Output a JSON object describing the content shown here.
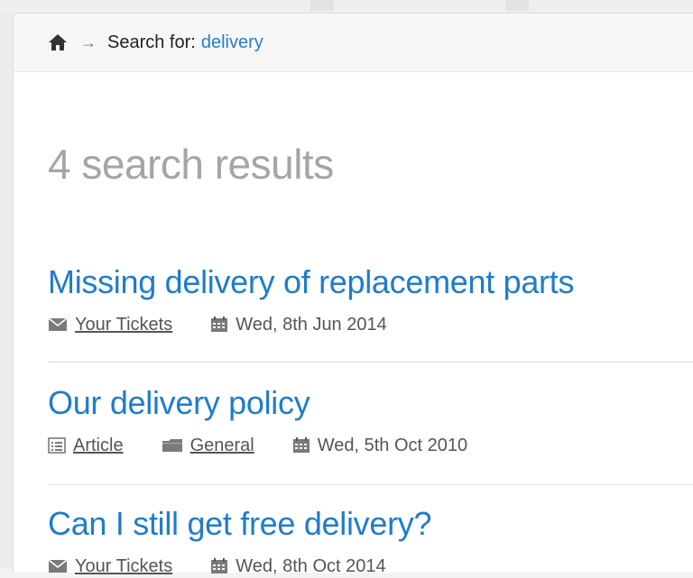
{
  "breadcrumb": {
    "home_icon": "home-icon",
    "separator": "→",
    "label": "Search for:",
    "query": "delivery"
  },
  "results_count": "4 search results",
  "results": [
    {
      "title": "Missing delivery of replacement parts",
      "meta": [
        {
          "icon": "envelope-icon",
          "text": "Your Tickets",
          "link": true
        },
        {
          "icon": "calendar-icon",
          "text": "Wed, 8th Jun 2014",
          "link": false
        }
      ]
    },
    {
      "title": "Our delivery policy",
      "meta": [
        {
          "icon": "article-icon",
          "text": "Article",
          "link": true
        },
        {
          "icon": "folder-icon",
          "text": "General",
          "link": true
        },
        {
          "icon": "calendar-icon",
          "text": "Wed, 5th Oct 2010",
          "link": false
        }
      ]
    },
    {
      "title": "Can I still get free delivery?",
      "meta": [
        {
          "icon": "envelope-icon",
          "text": "Your Tickets",
          "link": true
        },
        {
          "icon": "calendar-icon",
          "text": "Wed, 8th Oct 2014",
          "link": false
        }
      ]
    }
  ],
  "colors": {
    "link": "#1f7ccc",
    "muted_heading": "#a5a5a5",
    "meta_text": "#555555"
  }
}
